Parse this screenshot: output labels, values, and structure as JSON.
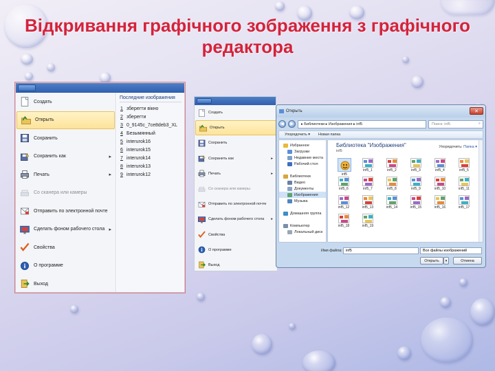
{
  "slide": {
    "title": "Відкривання графічного зображення  з графічного редактора"
  },
  "paint_menu_1": {
    "items": [
      {
        "label": "Создать",
        "icon": "new-file-icon",
        "disabled": false,
        "submenu": false,
        "highlight": false
      },
      {
        "label": "Открыть",
        "icon": "open-folder-icon",
        "disabled": false,
        "submenu": false,
        "highlight": true
      },
      {
        "label": "Сохранить",
        "icon": "save-icon",
        "disabled": false,
        "submenu": false,
        "highlight": false
      },
      {
        "label": "Сохранить как",
        "icon": "save-as-icon",
        "disabled": false,
        "submenu": true,
        "highlight": false
      },
      {
        "label": "Печать",
        "icon": "printer-icon",
        "disabled": false,
        "submenu": true,
        "highlight": false
      },
      {
        "label": "Со сканера или камеры",
        "icon": "scanner-icon",
        "disabled": true,
        "submenu": false,
        "highlight": false
      },
      {
        "label": "Отправить по электронной почте",
        "icon": "email-icon",
        "disabled": false,
        "submenu": false,
        "highlight": false
      },
      {
        "label": "Сделать фоном рабочего стола",
        "icon": "desktop-background-icon",
        "disabled": false,
        "submenu": true,
        "highlight": false
      },
      {
        "label": "Свойства",
        "icon": "checkmark-icon",
        "disabled": false,
        "submenu": false,
        "highlight": false
      },
      {
        "label": "О программе",
        "icon": "info-icon",
        "disabled": false,
        "submenu": false,
        "highlight": false
      },
      {
        "label": "Выход",
        "icon": "exit-icon",
        "disabled": false,
        "submenu": false,
        "highlight": false
      }
    ],
    "recent_header": "Последние изображения",
    "recent": [
      {
        "num": "1",
        "name": "зберегти вікно"
      },
      {
        "num": "2",
        "name": "зберегти"
      },
      {
        "num": "3",
        "name": "0_9145c_7ce8deb3_XL"
      },
      {
        "num": "4",
        "name": "Безымянный"
      },
      {
        "num": "5",
        "name": "interurok16"
      },
      {
        "num": "6",
        "name": "interurok15"
      },
      {
        "num": "7",
        "name": "interurok14"
      },
      {
        "num": "8",
        "name": "interurok13"
      },
      {
        "num": "9",
        "name": "interurok12"
      }
    ]
  },
  "paint_menu_2": {
    "items": [
      {
        "label": "Создать",
        "icon": "new-file-icon",
        "disabled": false,
        "submenu": false,
        "highlight": false
      },
      {
        "label": "Открыть",
        "icon": "open-folder-icon",
        "disabled": false,
        "submenu": false,
        "highlight": true
      },
      {
        "label": "Сохранить",
        "icon": "save-icon",
        "disabled": false,
        "submenu": false,
        "highlight": false
      },
      {
        "label": "Сохранить как",
        "icon": "save-as-icon",
        "disabled": false,
        "submenu": true,
        "highlight": false
      },
      {
        "label": "Печать",
        "icon": "printer-icon",
        "disabled": false,
        "submenu": true,
        "highlight": false
      },
      {
        "label": "Со сканера или камеры",
        "icon": "scanner-icon",
        "disabled": true,
        "submenu": false,
        "highlight": false
      },
      {
        "label": "Отправить по электронной почте",
        "icon": "email-icon",
        "disabled": false,
        "submenu": false,
        "highlight": false
      },
      {
        "label": "Сделать фоном рабочего стола",
        "icon": "desktop-background-icon",
        "disabled": false,
        "submenu": true,
        "highlight": false
      },
      {
        "label": "Свойства",
        "icon": "checkmark-icon",
        "disabled": false,
        "submenu": false,
        "highlight": false
      },
      {
        "label": "О программе",
        "icon": "info-icon",
        "disabled": false,
        "submenu": false,
        "highlight": false
      },
      {
        "label": "Выход",
        "icon": "exit-icon",
        "disabled": false,
        "submenu": false,
        "highlight": false
      }
    ]
  },
  "open_dialog": {
    "title": "Открыть",
    "address": "▸ Библиотеки ▸ Изображения ▸ inf5",
    "search_placeholder": "Поиск: inf5",
    "toolbar": {
      "organize": "Упорядочить ▾",
      "new_folder": "Новая папка"
    },
    "nav": [
      {
        "label": "Избранное",
        "color": "#e8b93a",
        "highlight": false
      },
      {
        "label": "Загрузки",
        "color": "#5b8fd6",
        "highlight": false
      },
      {
        "label": "Недавние места",
        "color": "#7aa0c9",
        "highlight": false
      },
      {
        "label": "Рабочий стол",
        "color": "#3d6fbf",
        "highlight": false
      },
      {
        "label": "",
        "color": "",
        "highlight": false
      },
      {
        "label": "Библиотеки",
        "color": "#d6a63e",
        "highlight": false
      },
      {
        "label": "Видео",
        "color": "#6a7fa3",
        "highlight": false
      },
      {
        "label": "Документы",
        "color": "#8aa3c4",
        "highlight": false
      },
      {
        "label": "Изображения",
        "color": "#5fa46b",
        "highlight": true
      },
      {
        "label": "Музыка",
        "color": "#4e86c6",
        "highlight": false
      },
      {
        "label": "",
        "color": "",
        "highlight": false
      },
      {
        "label": "Домашняя группа",
        "color": "#3c8fc8",
        "highlight": false
      },
      {
        "label": "",
        "color": "",
        "highlight": false
      },
      {
        "label": "Компьютер",
        "color": "#7a8fa8",
        "highlight": false
      },
      {
        "label": "Локальный диск",
        "color": "#9aa7b8",
        "highlight": false
      }
    ],
    "library_title": "Библиотека \"Изображения\"",
    "library_sub": "inf5",
    "arrange_label": "Упорядочить:",
    "arrange_value": "Папка ▾",
    "files": [
      "inf5",
      "inf5_1",
      "inf5_2",
      "inf5_3",
      "inf5_4",
      "inf5_5",
      "inf5_6",
      "inf5_7",
      "inf5_8",
      "inf5_9",
      "inf5_10",
      "inf5_11",
      "inf5_12",
      "inf5_13",
      "inf5_14",
      "inf5_15",
      "inf5_16",
      "inf5_17",
      "inf5_18",
      "inf5_19"
    ],
    "file_name_label": "Имя файла:",
    "file_name_value": "inf5",
    "file_type_value": "Все файлы изображений",
    "open_button": "Открыть",
    "cancel_button": "Отмена"
  },
  "colors": {
    "title": "#d4233b",
    "menu_highlight": "#fde39a",
    "dialog_frame": "#c7d9ee"
  }
}
